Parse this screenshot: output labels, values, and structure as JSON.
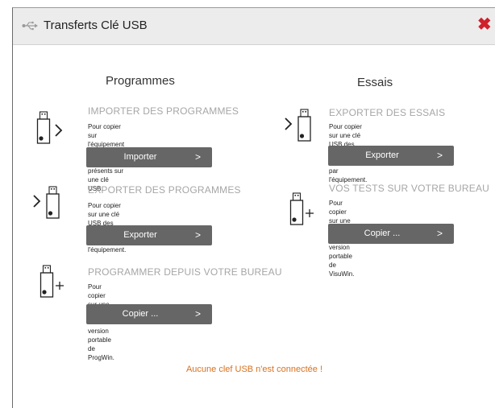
{
  "window": {
    "title": "Transferts Clé USB",
    "close_icon": "close-x-icon",
    "close_color": "#d0202b"
  },
  "columns": {
    "left_title": "Programmes",
    "right_title": "Essais"
  },
  "sections": {
    "import_programs": {
      "title": "IMPORTER DES PROGRAMMES",
      "desc_1": "Pour copier sur l'équipement des programmes",
      "desc_2": "présents sur une clé USB.",
      "button": "Importer",
      "icon": "usb-import-icon"
    },
    "export_programs": {
      "title": "EXPORTER DES PROGRAMMES",
      "desc_1": "Pour copier sur une clé USB des programmes",
      "desc_2": "présents sur l'équipement.",
      "button": "Exporter",
      "icon": "usb-export-icon"
    },
    "program_desktop": {
      "title": "PROGRAMMER DEPUIS VOTRE BUREAU",
      "desc_1": "Pour copier sur une clé USB une version portable",
      "desc_2": "de ProgWin.",
      "button": "Copier ...",
      "icon": "usb-add-icon"
    },
    "export_tests": {
      "title": "EXPORTER DES ESSAIS",
      "desc_1": "Pour copier sur une clé USB des essais réalisés",
      "desc_2": "par l'équipement.",
      "button": "Exporter",
      "icon": "usb-export-icon"
    },
    "tests_desktop": {
      "title": "VOS TESTS SUR VOTRE BUREAU",
      "desc_1": "Pour copier sur une clé USB une version portable",
      "desc_2": "de VisuWin.",
      "button": "Copier ...",
      "icon": "usb-add-icon"
    }
  },
  "button_chevron": ">",
  "status": {
    "text": "Aucune clef USB n'est connectée !",
    "color": "#d9711e"
  },
  "colors": {
    "button_bg": "#666666",
    "section_title": "#a6a6a6",
    "titlebar_bg": "#ececec"
  }
}
